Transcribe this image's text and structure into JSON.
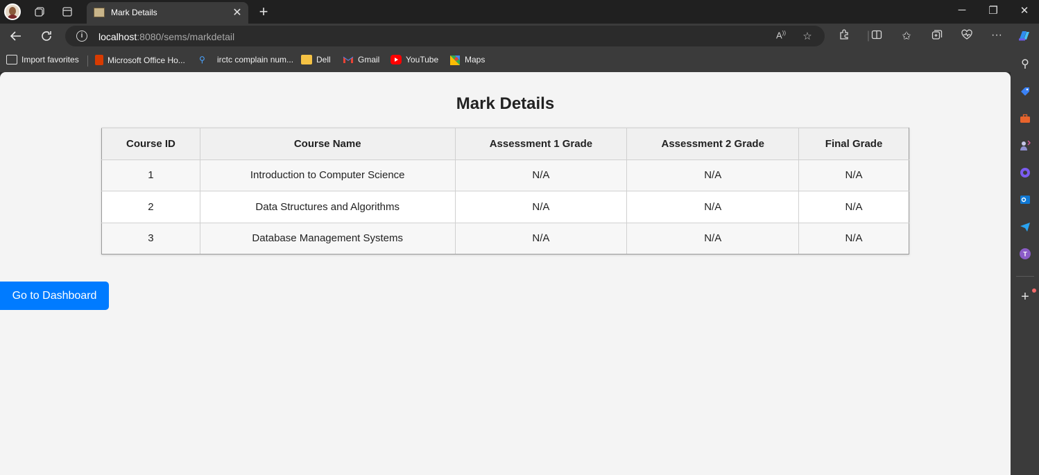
{
  "browser": {
    "tab_title": "Mark Details",
    "new_tab_symbol": "+",
    "url_host": "localhost",
    "url_path": ":8080/sems/markdetail",
    "bookmarks": [
      {
        "label": "Import favorites",
        "icon": "import-icon"
      },
      {
        "label": "Microsoft Office Ho...",
        "icon": "office-icon"
      },
      {
        "label": "irctc complain num...",
        "icon": "search-icon"
      },
      {
        "label": "Dell",
        "icon": "folder-icon"
      },
      {
        "label": "Gmail",
        "icon": "gmail-icon"
      },
      {
        "label": "YouTube",
        "icon": "youtube-icon"
      },
      {
        "label": "Maps",
        "icon": "maps-icon"
      }
    ]
  },
  "page": {
    "title": "Mark Details",
    "table": {
      "headers": [
        "Course ID",
        "Course Name",
        "Assessment 1 Grade",
        "Assessment 2 Grade",
        "Final Grade"
      ],
      "rows": [
        [
          "1",
          "Introduction to Computer Science",
          "N/A",
          "N/A",
          "N/A"
        ],
        [
          "2",
          "Data Structures and Algorithms",
          "N/A",
          "N/A",
          "N/A"
        ],
        [
          "3",
          "Database Management Systems",
          "N/A",
          "N/A",
          "N/A"
        ]
      ]
    },
    "dashboard_button": "Go to Dashboard"
  },
  "colors": {
    "accent": "#007bff",
    "page_bg": "#f4f4f4",
    "browser_chrome": "#3b3b3b"
  }
}
